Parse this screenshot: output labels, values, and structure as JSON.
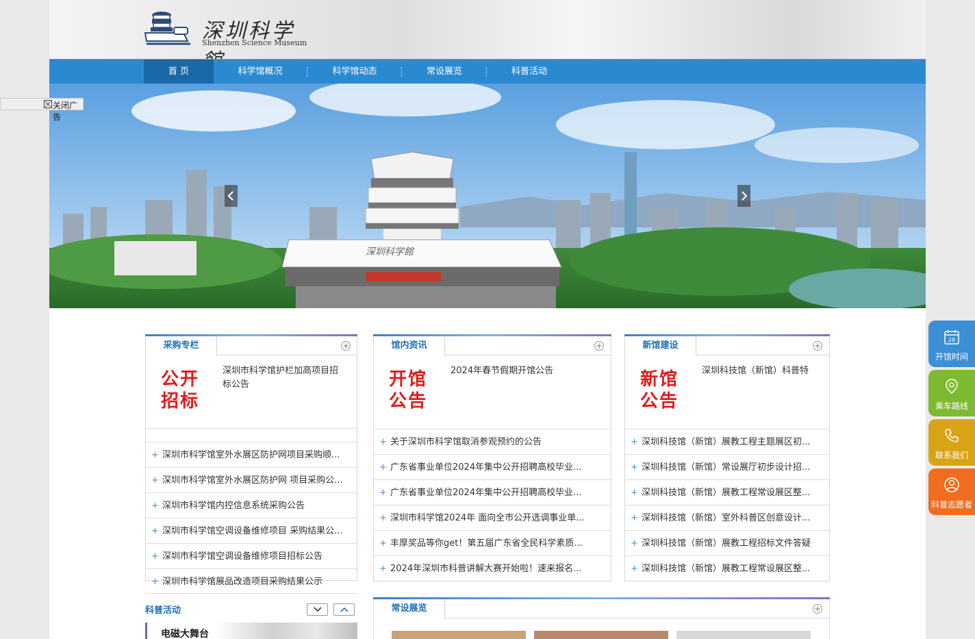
{
  "header": {
    "logo_cn": "深圳科学館",
    "logo_en": "Shenzhen Science Museum"
  },
  "nav": {
    "items": [
      {
        "label": "首 页",
        "active": true
      },
      {
        "label": "科学馆概况"
      },
      {
        "label": "科学馆动态"
      },
      {
        "label": "常设展览"
      },
      {
        "label": "科普活动"
      }
    ]
  },
  "banner": {
    "building_sign": "深圳科学館",
    "prev_icon": "chevron-left-icon",
    "next_icon": "chevron-right-icon"
  },
  "close_ad": {
    "label": "关闭广告"
  },
  "panels": {
    "purchase": {
      "tab": "采购专栏",
      "promo": [
        "公开",
        "招标"
      ],
      "lead": "深圳市科学馆护栏加高项目招标公告",
      "items": [
        "深圳市科学馆室外水展区防护网项目采购顺...",
        "深圳市科学馆室外水展区防护网 项目采购公...",
        "深圳市科学馆内控信息系统采购公告",
        "深圳市科学馆空调设备维修项目 采购结果公...",
        "深圳市科学馆空调设备维修项目招标公告",
        "深圳市科学馆展品改造项目采购结果公示"
      ]
    },
    "news": {
      "tab": "馆内资讯",
      "promo": [
        "开馆",
        "公告"
      ],
      "lead": "2024年春节假期开馆公告",
      "items": [
        "关于深圳市科学馆取消参观预约的公告",
        "广东省事业单位2024年集中公开招聘高校毕业...",
        "广东省事业单位2024年集中公开招聘高校毕业...",
        "深圳市科学馆2024年 面向全市公开选调事业单...",
        "丰厚奖品等你get！第五届广东省全民科学素质...",
        "2024年深圳市科普讲解大赛开始啦！速来报名..."
      ]
    },
    "newhall": {
      "tab": "新馆建设",
      "promo": [
        "新馆",
        "公告"
      ],
      "lead": "深圳科技馆（新馆）科普特",
      "items": [
        "深圳科技馆（新馆）展教工程主题展区初...",
        "深圳科技馆（新馆）常设展厅初步设计招...",
        "深圳科技馆（新馆）展教工程常设展区整...",
        "深圳科技馆（新馆）室外科普区创意设计...",
        "深圳科技馆（新馆）展教工程招标文件答疑",
        "深圳科技馆（新馆）展教工程常设展区整..."
      ]
    },
    "exhibit": {
      "tab": "常设展览"
    }
  },
  "activity": {
    "title": "科普活动",
    "caption": "电磁大舞台",
    "down_icon": "chevron-down-icon",
    "up_icon": "chevron-up-icon"
  },
  "side": [
    {
      "label": "开馆时间",
      "icon": "calendar-icon",
      "day": "28",
      "color": "#3b8fd4"
    },
    {
      "label": "乘车路线",
      "icon": "location-pin-icon",
      "color": "#7dba2f"
    },
    {
      "label": "联系我们",
      "icon": "phone-icon",
      "color": "#d9a316"
    },
    {
      "label": "科普志愿者",
      "icon": "volunteer-icon",
      "color": "#f06c1f"
    }
  ]
}
